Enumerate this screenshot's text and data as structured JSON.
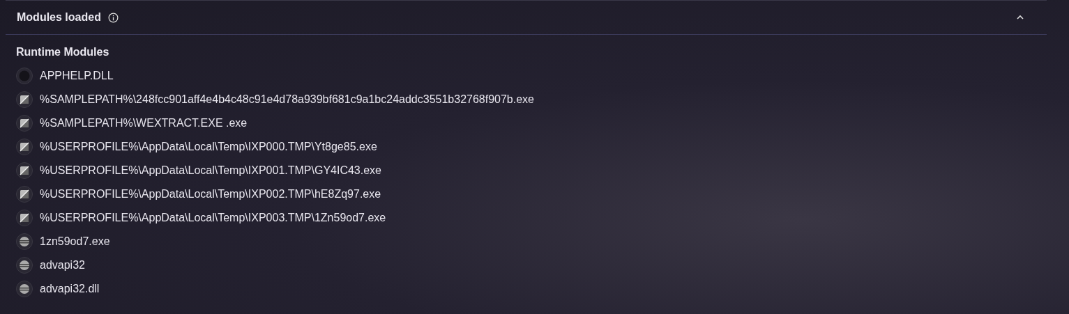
{
  "section": {
    "title": "Modules loaded",
    "expanded": true
  },
  "group": {
    "title": "Runtime Modules"
  },
  "modules": [
    {
      "kind": "dark",
      "name": "APPHELP.DLL"
    },
    {
      "kind": "split",
      "name": "%SAMPLEPATH%\\248fcc901aff4e4b4c48c91e4d78a939bf681c9a1bc24addc3551b32768f907b.exe"
    },
    {
      "kind": "split",
      "name": "%SAMPLEPATH%\\WEXTRACT.EXE .exe"
    },
    {
      "kind": "split",
      "name": "%USERPROFILE%\\AppData\\Local\\Temp\\IXP000.TMP\\Yt8ge85.exe"
    },
    {
      "kind": "split",
      "name": "%USERPROFILE%\\AppData\\Local\\Temp\\IXP001.TMP\\GY4IC43.exe"
    },
    {
      "kind": "split",
      "name": "%USERPROFILE%\\AppData\\Local\\Temp\\IXP002.TMP\\hE8Zq97.exe"
    },
    {
      "kind": "split",
      "name": "%USERPROFILE%\\AppData\\Local\\Temp\\IXP003.TMP\\1Zn59od7.exe"
    },
    {
      "kind": "striped",
      "name": "1zn59od7.exe"
    },
    {
      "kind": "striped",
      "name": "advapi32"
    },
    {
      "kind": "striped",
      "name": "advapi32.dll"
    }
  ]
}
